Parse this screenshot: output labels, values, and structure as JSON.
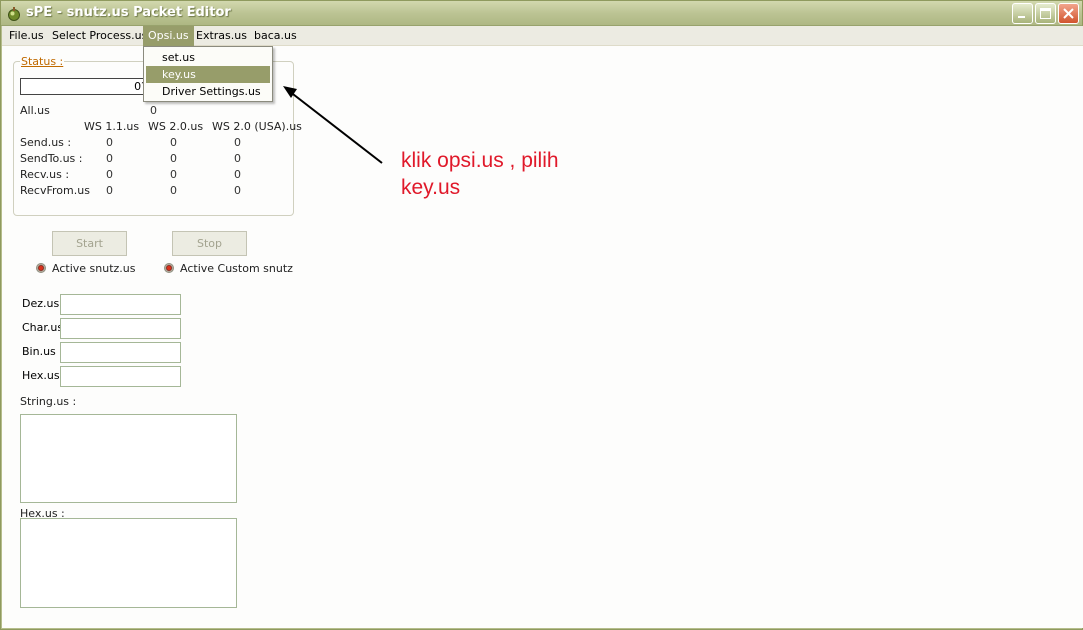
{
  "window": {
    "title": "sPE - snutz.us Packet Editor",
    "colors": {
      "accent": "#979d6a",
      "annotation": "#e0192a",
      "group_title": "#c06a00"
    }
  },
  "menubar": {
    "items": [
      "File.us",
      "Select Process.us",
      "Opsi.us",
      "Extras.us",
      "baca.us"
    ],
    "active": "Opsi.us"
  },
  "dropdown": {
    "items": [
      "set.us",
      "key.us",
      "Driver Settings.us"
    ],
    "highlighted": "key.us"
  },
  "status": {
    "title": "Status :",
    "progress_text": "0?",
    "all_label": "All.us",
    "all_value": "0",
    "columns": [
      "WS 1.1.us",
      "WS 2.0.us",
      "WS 2.0 (USA).us"
    ],
    "rows": [
      {
        "label": "Send.us :",
        "values": [
          "0",
          "0",
          "0"
        ]
      },
      {
        "label": "SendTo.us :",
        "values": [
          "0",
          "0",
          "0"
        ]
      },
      {
        "label": "Recv.us :",
        "values": [
          "0",
          "0",
          "0"
        ]
      },
      {
        "label": "RecvFrom.us",
        "values": [
          "0",
          "0",
          "0"
        ]
      }
    ]
  },
  "controls": {
    "start_label": "Start",
    "stop_label": "Stop",
    "radio_snutz": "Active snutz.us",
    "radio_custom": "Active Custom snutz"
  },
  "converter": {
    "dez_label": "Dez.us :",
    "char_label": "Char.us",
    "bin_label": "Bin.us :",
    "hex_label": "Hex.us :",
    "string_label": "String.us :",
    "hex_area_label": "Hex.us :"
  },
  "annotation": {
    "line1": "klik opsi.us , pilih",
    "line2": "key.us"
  }
}
